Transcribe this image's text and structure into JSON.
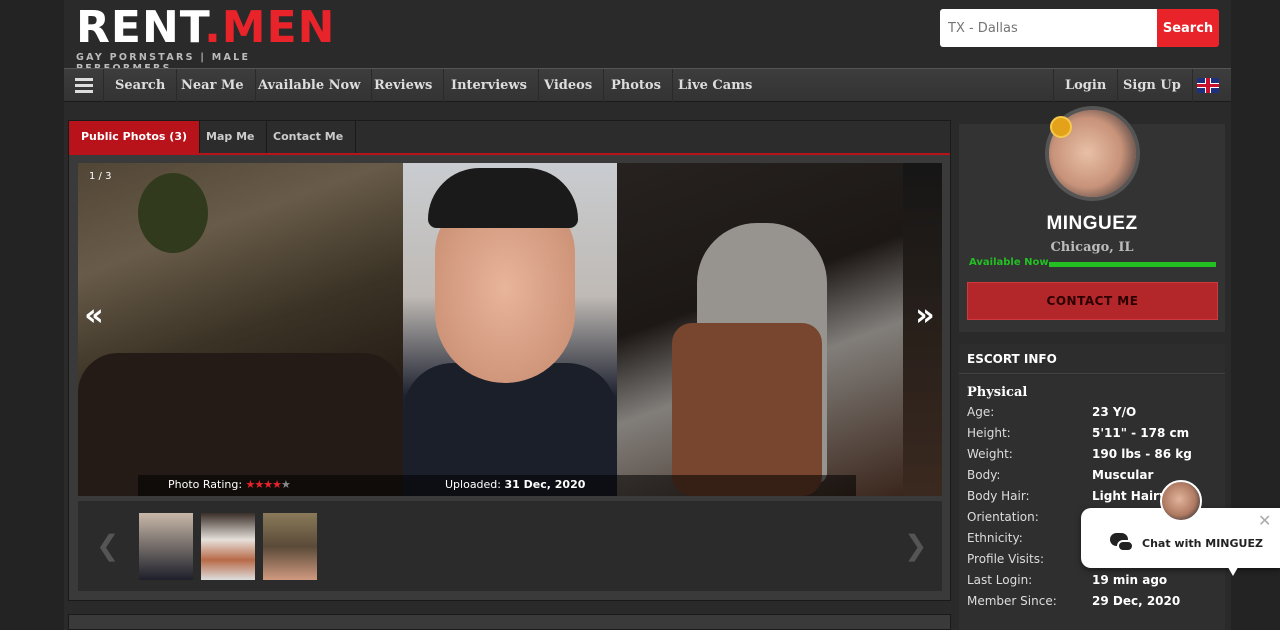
{
  "header": {
    "logo_main": "RENT",
    "logo_dot": ".MEN",
    "logo_tagline": "GAY PORNSTARS | MALE PERFORMERS",
    "search_placeholder": "TX - Dallas",
    "search_button": "Search"
  },
  "nav": {
    "items": [
      "Search",
      "Near Me",
      "Available Now",
      "Reviews",
      "Interviews",
      "Videos",
      "Photos",
      "Live Cams"
    ],
    "login": "Login",
    "signup": "Sign Up",
    "flag_icon": "uk-flag-icon"
  },
  "tabs": [
    "Public Photos (3)",
    "Map Me",
    "Contact Me"
  ],
  "gallery": {
    "counter": "1 / 3",
    "prev": "«",
    "next": "»",
    "rating_label": "Photo Rating:",
    "rating_stars": 4,
    "rating_max": 5,
    "uploaded_label": "Uploaded:",
    "uploaded_date": "31 Dec, 2020",
    "thumb_prev": "❮",
    "thumb_next": "❯"
  },
  "profile": {
    "name": "MINGUEZ",
    "location": "Chicago, IL",
    "status": "Available Now",
    "contact_button": "CONTACT ME"
  },
  "escort_info": {
    "heading": "ESCORT INFO",
    "section": "Physical",
    "rows": [
      {
        "k": "Age:",
        "v": "23 Y/O"
      },
      {
        "k": "Height:",
        "v": "5'11\" - 178 cm"
      },
      {
        "k": "Weight:",
        "v": "190 lbs - 86 kg"
      },
      {
        "k": "Body:",
        "v": "Muscular"
      },
      {
        "k": "Body Hair:",
        "v": "Light Hairy"
      },
      {
        "k": "Orientation:",
        "v": ""
      },
      {
        "k": "Ethnicity:",
        "v": ""
      },
      {
        "k": "Profile Visits:",
        "v": ""
      },
      {
        "k": "Last Login:",
        "v": "19 min ago"
      },
      {
        "k": "Member Since:",
        "v": "29 Dec, 2020"
      }
    ]
  },
  "chat": {
    "label": "Chat with MINGUEZ",
    "close": "✕"
  },
  "colors": {
    "accent": "#e8232a",
    "available": "#23c023",
    "contact": "#b3262a"
  }
}
